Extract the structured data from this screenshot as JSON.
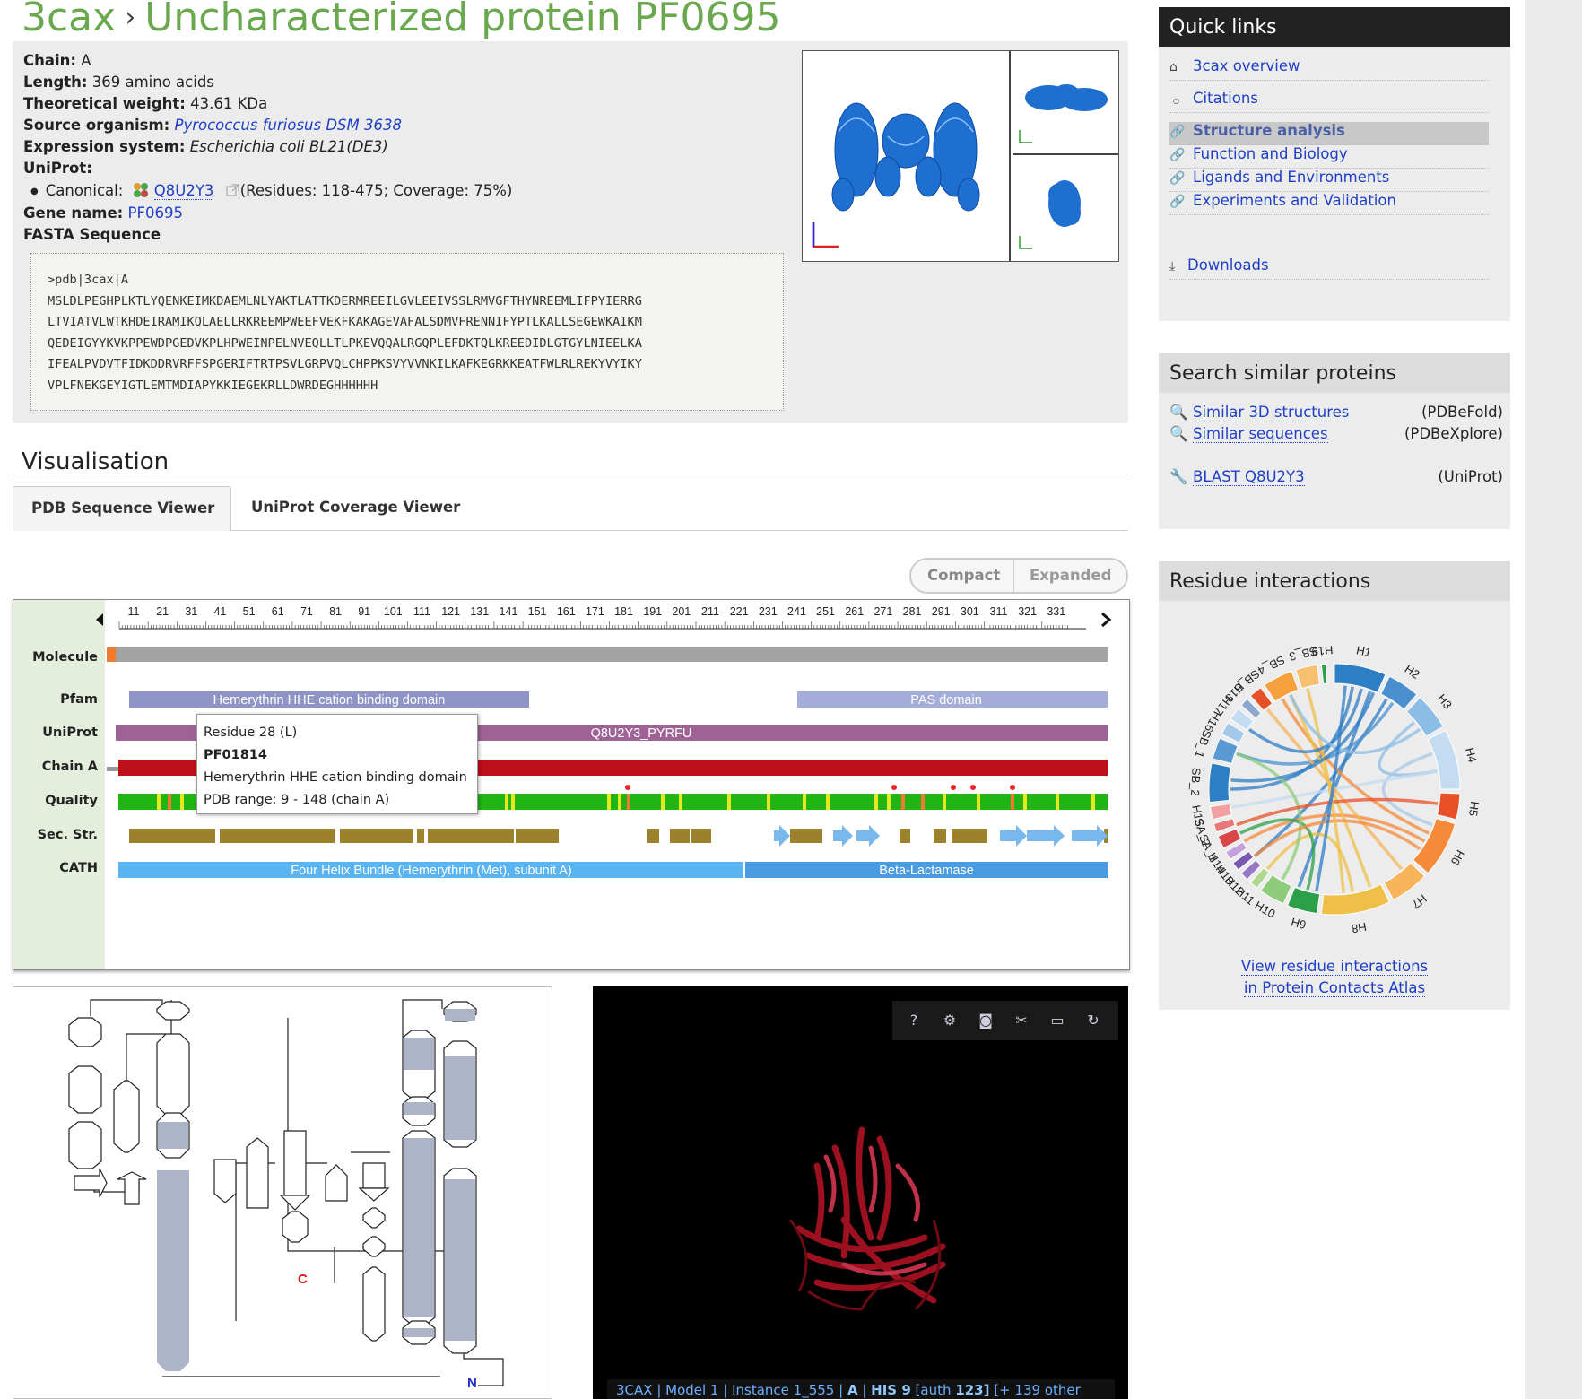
{
  "header": {
    "pdb_id": "3cax",
    "separator": "›",
    "title": "Uncharacterized protein PF0695"
  },
  "info": {
    "chain_label": "Chain:",
    "chain_value": "A",
    "length_label": "Length:",
    "length_value": "369 amino acids",
    "weight_label": "Theoretical weight:",
    "weight_value": "43.61 KDa",
    "source_label": "Source organism:",
    "source_value": "Pyrococcus furiosus DSM 3638",
    "expression_label": "Expression system:",
    "expression_value": "Escherichia coli BL21(DE3)",
    "uniprot_label": "UniProt:",
    "canonical_label": "Canonical:",
    "canonical_accession": "Q8U2Y3",
    "canonical_detail": "(Residues: 118-475; Coverage: 75%)",
    "gene_label": "Gene name:",
    "gene_value": "PF0695",
    "fasta_label": "FASTA Sequence"
  },
  "fasta": {
    "header": ">pdb|3cax|A",
    "lines": [
      "MSLDLPEGHPLKTLYQENKEIMKDAEMLNLYAKTLATTKDERMREEILGVLEEIVSSLRMVGFTHYNREEMLIFPYIERRG",
      "LTVIATVLWTKHDEIRAMIKQLAELLRKREEMPWEEFVEKFKAKAGEVAFALSDMVFRENNIFYPTLKALLSEGEWKAIKM",
      "QEDEIGYYKVKPPEWDPGEDVKPLHPWEINPELNVEQLLTLPKEVQQALRGQPLEFDKTQLKREEDIDLGTGYLNIEELKA",
      "IFEALPVDVTFIDKDDRVRFFSPGERIFTRTPSVLGRPVQLCHPPKSVYVVNKILKAFKEGRKKEATFWLRLREKYVYIKY",
      "VPLFNEKGEYIGTLEMTMDIAPYKKIEGEKRLLDWRDEGHHHHHH"
    ]
  },
  "visualisation": {
    "title": "Visualisation",
    "tabs": [
      "PDB Sequence Viewer",
      "UniProt Coverage Viewer"
    ],
    "toggle": [
      "Compact",
      "Expanded"
    ]
  },
  "sequence_viewer": {
    "ruler_ticks": [
      "11",
      "21",
      "31",
      "41",
      "51",
      "61",
      "71",
      "81",
      "91",
      "101",
      "111",
      "121",
      "131",
      "141",
      "151",
      "161",
      "171",
      "181",
      "191",
      "201",
      "211",
      "221",
      "231",
      "241",
      "251",
      "261",
      "271",
      "281",
      "291",
      "301",
      "311",
      "321",
      "331"
    ],
    "tracks": [
      "Molecule",
      "Pfam",
      "UniProt",
      "Chain A",
      "Quality",
      "Sec. Str.",
      "CATH"
    ],
    "pfam_1": "Hemerythrin HHE cation binding domain",
    "pfam_2": "PAS domain",
    "uniprot_bar": "Q8U2Y3_PYRFU",
    "cath_1": "Four Helix Bundle (Hemerythrin (Met), subunit A)",
    "cath_2": "Beta-Lactamase",
    "colors": {
      "molecule": "#a3a3a3",
      "pfam": "#8e94c5",
      "pfam2": "#a4add9",
      "uniprot": "#9e6394",
      "chain": "#bd0f17",
      "quality": "#21b514",
      "secstr": "#9b812b",
      "strand": "#78b8ec",
      "cath": "#5ab4f2",
      "cath2": "#4a9ce2"
    },
    "tooltip": {
      "residue": "Residue 28 (L)",
      "pfam_id": "PF01814",
      "name": "Hemerythrin HHE cation binding domain",
      "range": "PDB range: 9 - 148 (chain A)"
    }
  },
  "topology": {
    "c_label": "C",
    "n_label": "N"
  },
  "molstar": {
    "status": {
      "entry": "3CAX",
      "model": "Model 1",
      "instance": "Instance 1_555",
      "chain": "A",
      "residue": "HIS 9",
      "auth_prefix": "[auth",
      "auth_num": "123]",
      "other": "[+ 139 other"
    },
    "toolbar_icons": [
      "help-icon",
      "settings-icon",
      "camera-icon",
      "tools-icon",
      "expand-icon",
      "reset-icon"
    ]
  },
  "quick_links": {
    "title": "Quick links",
    "items": [
      {
        "label": "3cax overview",
        "icon": "home-icon"
      },
      {
        "label": "Citations",
        "icon": "bullet-icon"
      },
      {
        "label": "Structure analysis",
        "icon": "link-icon"
      },
      {
        "label": "Function and Biology",
        "icon": "link-icon"
      },
      {
        "label": "Ligands and Environments",
        "icon": "link-icon"
      },
      {
        "label": "Experiments and Validation",
        "icon": "link-icon"
      }
    ],
    "downloads": "Downloads"
  },
  "search_similar": {
    "title": "Search similar proteins",
    "rows": [
      {
        "label": "Similar 3D structures",
        "source": "(PDBeFold)"
      },
      {
        "label": "Similar sequences",
        "source": "(PDBeXplore)"
      },
      {
        "label": "BLAST Q8U2Y3",
        "source": "(UniProt)"
      }
    ]
  },
  "residue_interactions": {
    "title": "Residue interactions",
    "labels": [
      "H1",
      "H2",
      "H3",
      "H4",
      "H5",
      "H6",
      "H7",
      "H8",
      "H9",
      "H10",
      "H11",
      "H12",
      "H13",
      "H14",
      "SA_1",
      "SA_2",
      "H15",
      "SB_2",
      "SB_1",
      "H16",
      "H17",
      "H18",
      "SB_5",
      "SB_4",
      "SB_3",
      "H19"
    ],
    "link_line1": "View residue interactions",
    "link_line2": "in Protein Contacts Atlas"
  }
}
